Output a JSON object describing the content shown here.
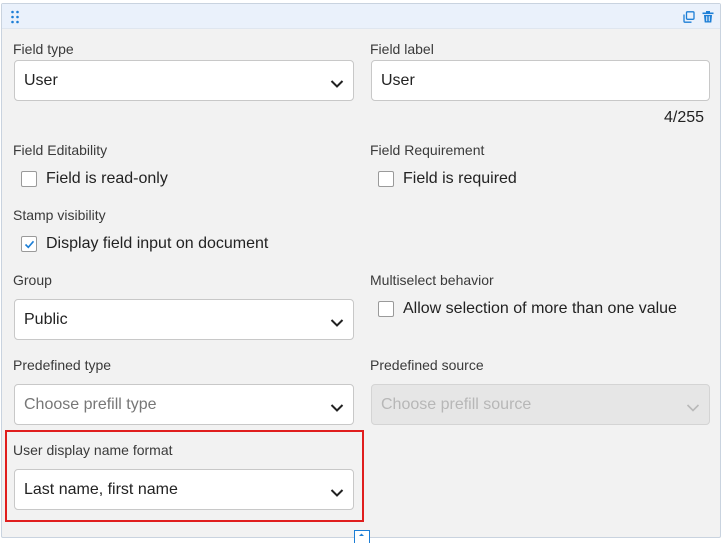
{
  "header": {
    "drag_icon": "drag-handle-icon",
    "copy_icon": "copy-icon",
    "delete_icon": "trash-icon",
    "accent": "#1c7ed6"
  },
  "form": {
    "field_type": {
      "label": "Field type",
      "value": "User"
    },
    "field_label": {
      "label": "Field label",
      "value": "User",
      "counter": "4/255"
    },
    "editability": {
      "label": "Field Editability",
      "checkbox_label": "Field is read-only",
      "checked": false
    },
    "requirement": {
      "label": "Field Requirement",
      "checkbox_label": "Field is required",
      "checked": false
    },
    "stamp": {
      "label": "Stamp visibility",
      "checkbox_label": "Display field input on document",
      "checked": true
    },
    "group": {
      "label": "Group",
      "value": "Public"
    },
    "multiselect": {
      "label": "Multiselect behavior",
      "checkbox_label": "Allow selection of more than one value",
      "checked": false
    },
    "predefined_type": {
      "label": "Predefined type",
      "placeholder": "Choose prefill type"
    },
    "predefined_source": {
      "label": "Predefined source",
      "placeholder": "Choose prefill source",
      "disabled": true
    },
    "user_display": {
      "label": "User display name format",
      "value": "Last name, first name"
    }
  },
  "highlight_color": "#e01e1e"
}
